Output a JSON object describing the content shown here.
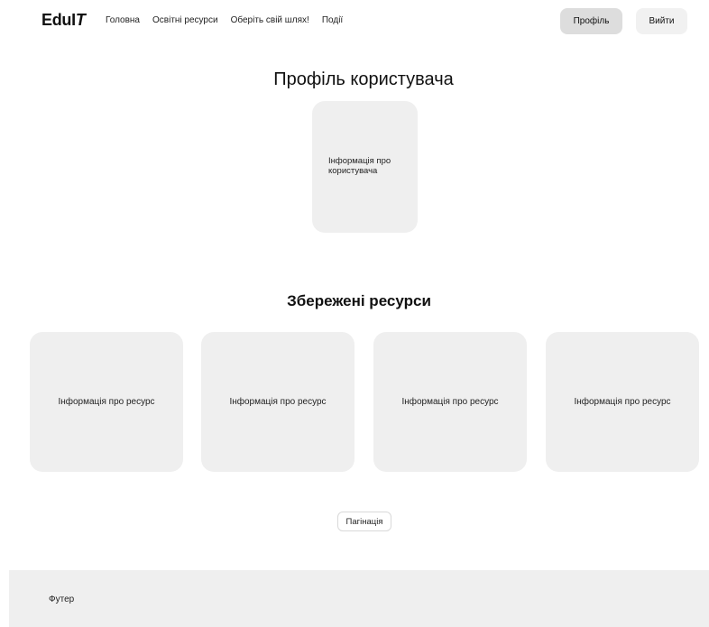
{
  "header": {
    "logo_main": "EduI",
    "logo_accent": "T",
    "nav": [
      {
        "label": "Головна"
      },
      {
        "label": "Освітні ресурси"
      },
      {
        "label": "Оберіть свій шлях!"
      },
      {
        "label": "Події"
      }
    ],
    "profile_button": "Профіль",
    "logout_button": "Вийти"
  },
  "profile": {
    "title": "Профіль користувача",
    "card_text": "Інформація про користувача"
  },
  "saved": {
    "title": "Збережені ресурси",
    "cards": [
      {
        "text": "Інформація про ресурс"
      },
      {
        "text": "Інформація про ресурс"
      },
      {
        "text": "Інформація про ресурс"
      },
      {
        "text": "Інформація про ресурс"
      }
    ]
  },
  "pagination": {
    "label": "Пагінація"
  },
  "footer": {
    "label": "Футер"
  },
  "colors": {
    "card_bg": "#efefef",
    "profile_button_bg": "#dddddd",
    "logout_button_bg": "#f1f1f1"
  }
}
